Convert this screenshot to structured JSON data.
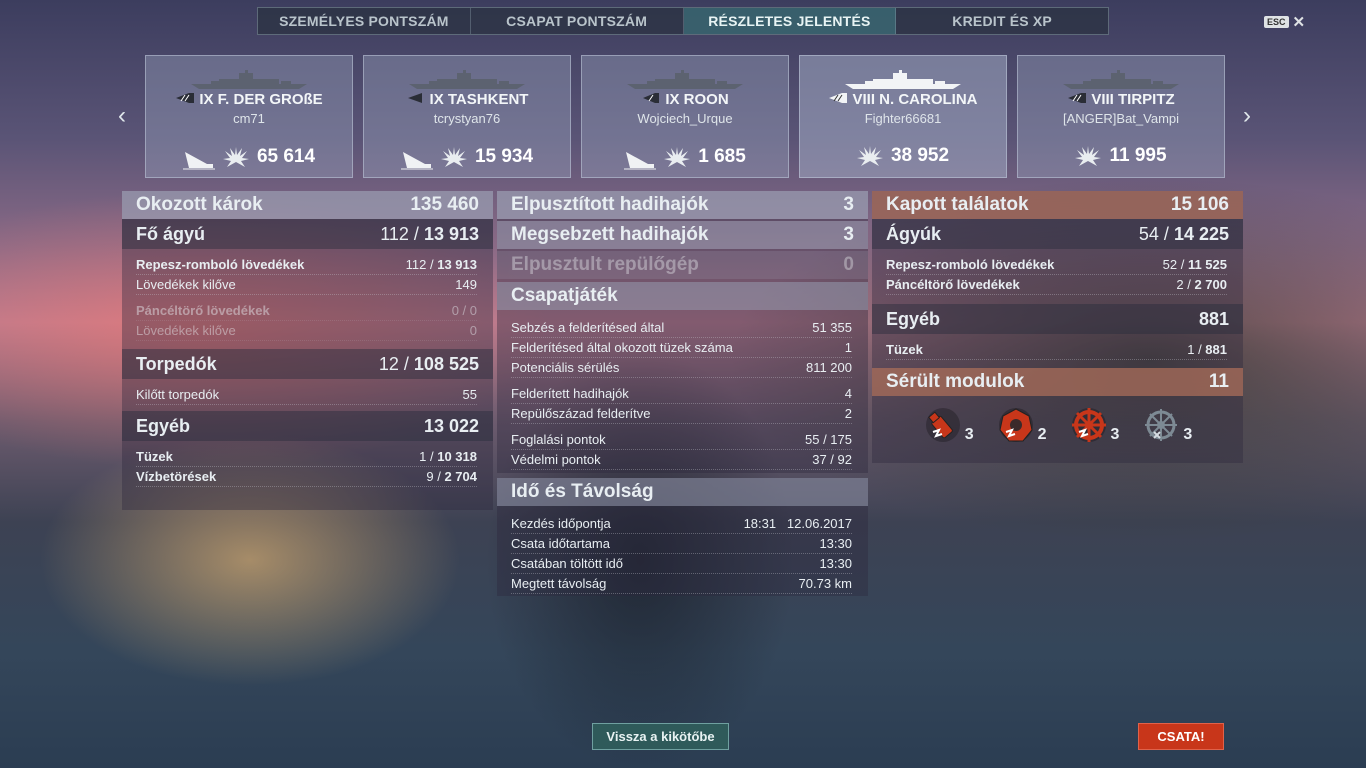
{
  "tabs": [
    {
      "label": "SZEMÉLYES PONTSZÁM",
      "active": false
    },
    {
      "label": "CSAPAT PONTSZÁM",
      "active": false
    },
    {
      "label": "RÉSZLETES JELENTÉS",
      "active": true
    },
    {
      "label": "KREDIT ÉS XP",
      "active": false
    }
  ],
  "esc": {
    "key": "ESC",
    "close": "✕"
  },
  "nav": {
    "prev": "‹",
    "next": "›"
  },
  "ships": [
    {
      "name": "IX F. DER GROßE",
      "player": "cm71",
      "damage": "65 614",
      "status": "sunk",
      "class": "battleship"
    },
    {
      "name": "IX TASHKENT",
      "player": "tcrystyan76",
      "damage": "15 934",
      "status": "sunk",
      "class": "destroyer"
    },
    {
      "name": "IX ROON",
      "player": "Wojciech_Urque",
      "damage": "1 685",
      "status": "sunk",
      "class": "cruiser"
    },
    {
      "name": "VIII N. CAROLINA",
      "player": "Fighter66681",
      "damage": "38 952",
      "status": "alive",
      "class": "battleship"
    },
    {
      "name": "VIII TIRPITZ",
      "player": "[ANGER]Bat_Vampi",
      "damage": "11 995",
      "status": "alive",
      "class": "battleship"
    }
  ],
  "damage_dealt": {
    "title": "Okozott károk",
    "total": "135 460",
    "main_guns": {
      "label": "Fő ágyú",
      "hits": "112",
      "total": "13 913"
    },
    "he": {
      "label": "Repesz-romboló lövedékek",
      "hits": "112",
      "total": "13 913"
    },
    "he_fired": {
      "label": "Lövedékek kilőve",
      "value": "149"
    },
    "ap": {
      "label": "Páncéltörő lövedékek",
      "value": "0 / 0"
    },
    "ap_fired": {
      "label": "Lövedékek kilőve",
      "value": "0"
    },
    "torpedoes": {
      "label": "Torpedók",
      "hits": "12",
      "total": "108 525"
    },
    "torp_fired": {
      "label": "Kilőtt torpedók",
      "value": "55"
    },
    "other": {
      "label": "Egyéb",
      "total": "13 022"
    },
    "fires": {
      "label": "Tüzek",
      "hits": "1",
      "total": "10 318"
    },
    "floods": {
      "label": "Vízbetörések",
      "hits": "9",
      "total": "2 704"
    }
  },
  "combat": {
    "destroyed": {
      "label": "Elpusztított hadihajók",
      "value": "3"
    },
    "damaged": {
      "label": "Megsebzett hadihajók",
      "value": "3"
    },
    "planes": {
      "label": "Elpusztult repülőgép",
      "value": "0"
    }
  },
  "teamplay": {
    "title": "Csapatjáték",
    "rows": [
      {
        "label": "Sebzés a felderítésed által",
        "value": "51 355"
      },
      {
        "label": "Felderítésed által okozott tüzek száma",
        "value": "1"
      },
      {
        "label": "Potenciális sérülés",
        "value": "811 200"
      },
      {
        "label": "Felderített hadihajók",
        "value": "4"
      },
      {
        "label": "Repülőszázad felderítve",
        "value": "2"
      },
      {
        "label": "Foglalási pontok",
        "value": "55 / 175"
      },
      {
        "label": "Védelmi pontok",
        "value": "37 / 92"
      }
    ]
  },
  "time": {
    "title": "Idő és Távolság",
    "rows": [
      {
        "label": "Kezdés időpontja",
        "value": "18:31   12.06.2017"
      },
      {
        "label": "Csata időtartama",
        "value": "13:30"
      },
      {
        "label": "Csatában töltött idő",
        "value": "13:30"
      },
      {
        "label": "Megtett távolság",
        "value": "70.73 km"
      }
    ]
  },
  "received": {
    "title": "Kapott találatok",
    "total": "15 106",
    "guns": {
      "label": "Ágyúk",
      "hits": "54",
      "total": "14 225"
    },
    "he": {
      "label": "Repesz-romboló lövedékek",
      "hits": "52",
      "total": "11 525"
    },
    "ap": {
      "label": "Páncéltörő lövedékek",
      "hits": "2",
      "total": "2 700"
    },
    "other": {
      "label": "Egyéb",
      "total": "881"
    },
    "fires": {
      "label": "Tüzek",
      "hits": "1",
      "total": "881"
    }
  },
  "modules": {
    "title": "Sérült modulok",
    "total": "11",
    "items": [
      {
        "icon": "torpedo-tube-damaged-icon",
        "count": "3",
        "color": "#c8361a"
      },
      {
        "icon": "main-battery-damaged-icon",
        "count": "2",
        "color": "#c8361a"
      },
      {
        "icon": "steering-damaged-icon",
        "count": "3",
        "color": "#c8361a"
      },
      {
        "icon": "steering-destroyed-icon",
        "count": "3",
        "color": "#7d8a94"
      }
    ]
  },
  "buttons": {
    "port": "Vissza a kikötőbe",
    "battle": "CSATA!"
  }
}
